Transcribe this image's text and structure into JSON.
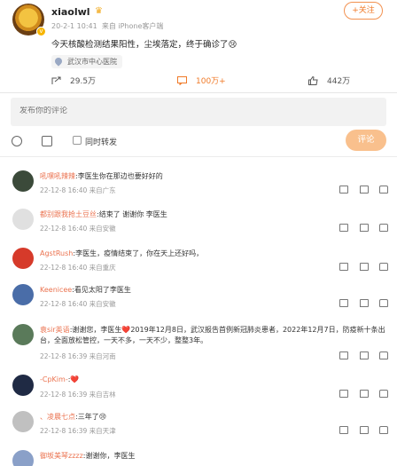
{
  "post": {
    "username": "xiaolwl",
    "date": "20-2-1 10:41",
    "source": "来自 iPhone客户端",
    "follow_label": "+关注",
    "text": "今天核酸检测结果阳性，尘埃落定，终于确诊了😢",
    "location": "武汉市中心医院",
    "shares": "29.5万",
    "comments": "100万+",
    "likes": "442万"
  },
  "composer": {
    "placeholder": "发布你的评论",
    "also_forward": "同时转发",
    "submit": "评论"
  },
  "comments": [
    {
      "name": "吼嘿吼辣辣",
      "text": ":李医生你在那边也要好好的",
      "time": "22-12-8 16:40",
      "from": "来自广东"
    },
    {
      "name": "都别跟我抢土豆丝",
      "text": ":结束了 谢谢你 李医生",
      "time": "22-12-8 16:40",
      "from": "来自安徽"
    },
    {
      "name": "AgstRush",
      "text": ":李医生，疫情结束了，你在天上还好吗，",
      "time": "22-12-8 16:40",
      "from": "来自重庆"
    },
    {
      "name": "Keenicee",
      "text": ":看见太阳了李医生",
      "time": "22-12-8 16:40",
      "from": "来自安徽"
    },
    {
      "name": "袁sir英语",
      "text": ":谢谢您，李医生❤️2019年12月8日，武汉报告首例新冠肺炎患者，2022年12月7日，防疫新十条出台，全面放松管控，一天不多，一天不少，整整3年。",
      "time": "22-12-8 16:39",
      "from": "来自河南"
    },
    {
      "name": "-CpKim-",
      "text": ":❤️",
      "time": "22-12-8 16:39",
      "from": "来自吉林"
    },
    {
      "name": "、凌晨七点",
      "text": ":三年了😢",
      "time": "22-12-8 16:39",
      "from": "来自天津"
    },
    {
      "name": "御坂美琴zzzz",
      "text": ":谢谢你，李医生",
      "time": "",
      "from": ""
    }
  ],
  "colors": {
    "accent": "#f07a28",
    "commenter_name": "#eb7350",
    "submit_bg": "#f9c08d"
  }
}
